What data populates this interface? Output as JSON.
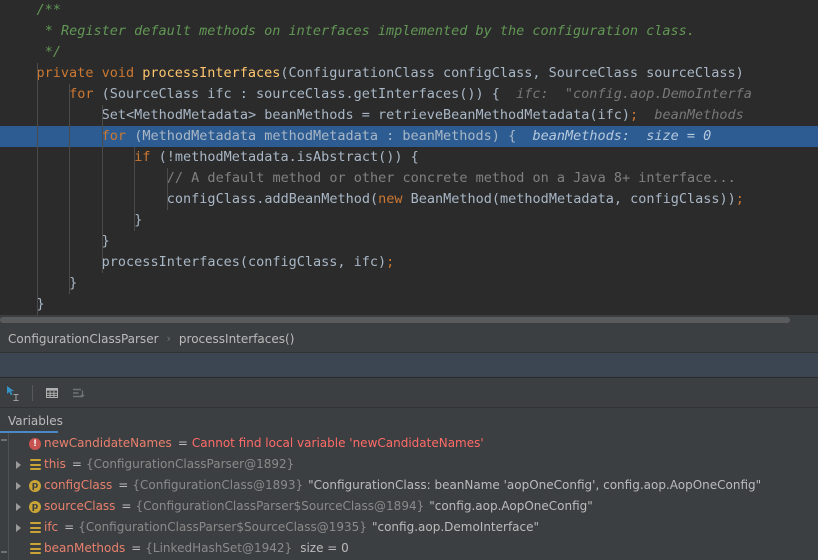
{
  "editor": {
    "lines": [
      {
        "indent": 4,
        "segments": [
          {
            "t": "/**",
            "c": "cmt"
          }
        ]
      },
      {
        "indent": 5,
        "segments": [
          {
            "t": "* Register default methods on interfaces implemented by the configuration class.",
            "c": "cmt"
          }
        ]
      },
      {
        "indent": 5,
        "segments": [
          {
            "t": "*/",
            "c": "cmt"
          }
        ]
      },
      {
        "indent": 4,
        "segments": [
          {
            "t": "private",
            "c": "kw"
          },
          {
            "t": " ",
            "c": "plain"
          },
          {
            "t": "void",
            "c": "kw"
          },
          {
            "t": " ",
            "c": "plain"
          },
          {
            "t": "processInterfaces",
            "c": "mth"
          },
          {
            "t": "(ConfigurationClass configClass, SourceClass sourceClass)",
            "c": "plain"
          }
        ]
      },
      {
        "indent": 8,
        "segments": [
          {
            "t": "for",
            "c": "kw"
          },
          {
            "t": " (SourceClass ifc : sourceClass.",
            "c": "plain"
          },
          {
            "t": "getInterfaces",
            "c": "plain"
          },
          {
            "t": "()) {",
            "c": "plain"
          },
          {
            "t": "  ifc:  \"config.aop.DemoInterfa",
            "c": "hint"
          }
        ]
      },
      {
        "indent": 12,
        "segments": [
          {
            "t": "Set<MethodMetadata> beanMethods = retrieveBeanMethodMetadata(ifc)",
            "c": "plain"
          },
          {
            "t": ";",
            "c": "kw"
          },
          {
            "t": "  beanMethods",
            "c": "hint"
          }
        ]
      },
      {
        "indent": 12,
        "highlight": true,
        "segments": [
          {
            "t": "for",
            "c": "kw"
          },
          {
            "t": " (MethodMetadata methodMetadata : beanMethods) {",
            "c": "plain"
          },
          {
            "t": "  beanMethods:  size = 0",
            "c": "hint-hl"
          }
        ]
      },
      {
        "indent": 16,
        "segments": [
          {
            "t": "if",
            "c": "kw"
          },
          {
            "t": " (!methodMetadata.isAbstract()) {",
            "c": "plain"
          }
        ]
      },
      {
        "indent": 20,
        "segments": [
          {
            "t": "// A default method or other concrete method on a Java 8+ interface...",
            "c": "lcmt"
          }
        ]
      },
      {
        "indent": 20,
        "segments": [
          {
            "t": "configClass.addBeanMethod(",
            "c": "plain"
          },
          {
            "t": "new",
            "c": "kw"
          },
          {
            "t": " BeanMethod(methodMetadata, configClass))",
            "c": "plain"
          },
          {
            "t": ";",
            "c": "kw"
          }
        ]
      },
      {
        "indent": 16,
        "segments": [
          {
            "t": "}",
            "c": "plain"
          }
        ]
      },
      {
        "indent": 12,
        "segments": [
          {
            "t": "}",
            "c": "plain"
          }
        ]
      },
      {
        "indent": 12,
        "segments": [
          {
            "t": "processInterfaces(configClass, ifc)",
            "c": "plain"
          },
          {
            "t": ";",
            "c": "kw"
          }
        ]
      },
      {
        "indent": 8,
        "segments": [
          {
            "t": "}",
            "c": "plain"
          }
        ]
      },
      {
        "indent": 4,
        "segments": [
          {
            "t": "}",
            "c": "plain"
          }
        ]
      }
    ]
  },
  "breadcrumb": {
    "class_name": "ConfigurationClassParser",
    "separator": "›",
    "method_name": "processInterfaces()"
  },
  "toolbar": {
    "icons": [
      {
        "name": "cursor-select-icon",
        "label": "Select in editor"
      },
      {
        "name": "table-view-icon",
        "label": "View as table"
      },
      {
        "name": "sort-values-icon",
        "label": "Sort values"
      }
    ]
  },
  "tabs": {
    "active": "Variables"
  },
  "variables": {
    "rows": [
      {
        "expandable": false,
        "icon": "error-icon",
        "icon_glyph": "!",
        "name": "newCandidateNames",
        "eq": "=",
        "error": "Cannot find local variable 'newCandidateNames'",
        "ref": "",
        "value": "",
        "size": ""
      },
      {
        "expandable": true,
        "icon": "field-icon",
        "icon_glyph": "",
        "name": "this",
        "eq": "=",
        "error": "",
        "ref": "{ConfigurationClassParser@1892}",
        "value": "",
        "size": ""
      },
      {
        "expandable": true,
        "icon": "parameter-icon",
        "icon_glyph": "p",
        "name": "configClass",
        "eq": "=",
        "error": "",
        "ref": "{ConfigurationClass@1893}",
        "value": "\"ConfigurationClass: beanName 'aopOneConfig', config.aop.AopOneConfig\"",
        "size": ""
      },
      {
        "expandable": true,
        "icon": "parameter-icon",
        "icon_glyph": "p",
        "name": "sourceClass",
        "eq": "=",
        "error": "",
        "ref": "{ConfigurationClassParser$SourceClass@1894}",
        "value": "\"config.aop.AopOneConfig\"",
        "size": ""
      },
      {
        "expandable": true,
        "icon": "field-icon",
        "icon_glyph": "",
        "name": "ifc",
        "eq": "=",
        "error": "",
        "ref": "{ConfigurationClassParser$SourceClass@1935}",
        "value": "\"config.aop.DemoInterface\"",
        "size": ""
      },
      {
        "expandable": false,
        "icon": "field-icon",
        "icon_glyph": "",
        "name": "beanMethods",
        "eq": "=",
        "error": "",
        "ref": "{LinkedHashSet@1942}",
        "value": "",
        "size": "size = 0"
      }
    ]
  },
  "colors": {
    "editor_bg": "#2b2b2b",
    "panel_bg": "#3c3f41",
    "highlight_line": "#2d5c93",
    "band_bg": "#3c4653",
    "accent_blue": "#4a88c7",
    "keyword": "#cc7832",
    "method": "#ffc66d",
    "javadoc": "#629755",
    "line_comment": "#808080",
    "inline_hint": "#787878",
    "var_name": "#e8806d",
    "error_red": "#ff6b68",
    "icon_yellow": "#c9a336",
    "text": "#a9b7c6"
  }
}
